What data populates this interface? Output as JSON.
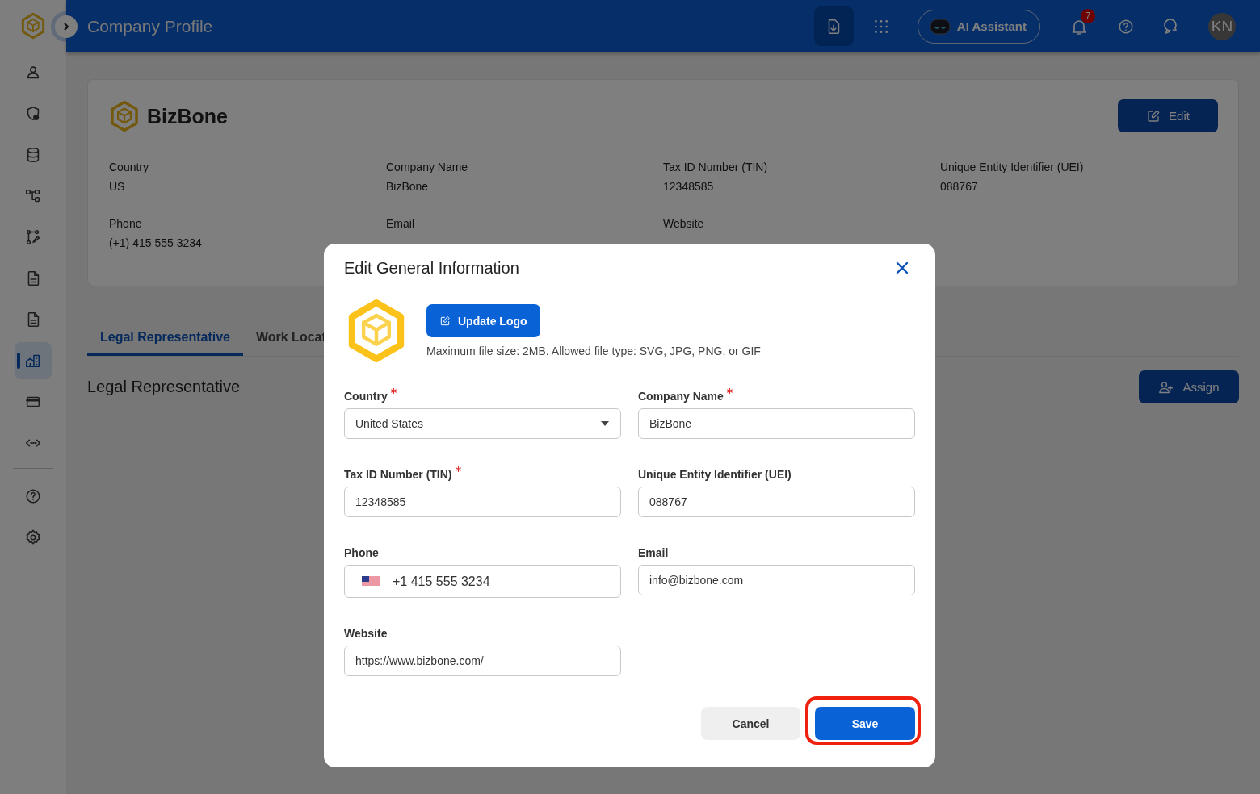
{
  "sidebar": {
    "items": [
      {
        "kind": "person",
        "selected": false
      },
      {
        "kind": "shield",
        "selected": false
      },
      {
        "kind": "database",
        "selected": false
      },
      {
        "kind": "hierarchy",
        "selected": false
      },
      {
        "kind": "workflow",
        "selected": false
      },
      {
        "kind": "document",
        "selected": false
      },
      {
        "kind": "document",
        "selected": false
      },
      {
        "kind": "building",
        "selected": true
      },
      {
        "kind": "card",
        "selected": false
      },
      {
        "kind": "code",
        "selected": false
      }
    ],
    "bottom_items": [
      {
        "kind": "help",
        "selected": false
      },
      {
        "kind": "settings",
        "selected": false
      }
    ]
  },
  "header": {
    "title": "Company Profile",
    "ai_button": "AI Assistant",
    "notification_count": "7",
    "avatar_initials": "KN"
  },
  "company_card": {
    "name": "BizBone",
    "edit_button": "Edit",
    "fields": [
      {
        "label": "Country",
        "value": "US"
      },
      {
        "label": "Company Name",
        "value": "BizBone"
      },
      {
        "label": "Tax ID Number (TIN)",
        "value": "12348585"
      },
      {
        "label": "Unique Entity Identifier (UEI)",
        "value": "088767"
      },
      {
        "label": "Phone",
        "value": "(+1) 415 555 3234"
      },
      {
        "label": "Email"
      },
      {
        "label": "Website"
      }
    ]
  },
  "tabs": [
    {
      "label": "Legal Representative",
      "selected": true
    },
    {
      "label": "Work Locat",
      "selected": false
    }
  ],
  "section": {
    "title": "Legal Representative",
    "assign_button": "Assign"
  },
  "dialog": {
    "title": "Edit General Information",
    "update_logo_button": "Update Logo",
    "logo_hint": "Maximum file size: 2MB. Allowed file type: SVG, JPG, PNG, or GIF",
    "fields": [
      {
        "kind": "select",
        "label": "Country",
        "required": true,
        "value": "United States"
      },
      {
        "kind": "text",
        "label": "Company Name",
        "required": true,
        "value": "BizBone"
      },
      {
        "kind": "text",
        "label": "Tax ID Number (TIN)",
        "required": true,
        "value": "12348585"
      },
      {
        "kind": "text",
        "label": "Unique Entity Identifier (UEI)",
        "required": false,
        "value": "088767"
      },
      {
        "kind": "phone",
        "label": "Phone",
        "required": false,
        "value": "+1 415 555 3234"
      },
      {
        "kind": "text",
        "label": "Email",
        "required": false,
        "value": "info@bizbone.com"
      },
      {
        "kind": "text",
        "label": "Website",
        "required": false,
        "value": "https://www.bizbone.com/"
      }
    ],
    "cancel_button": "Cancel",
    "save_button": "Save",
    "save_highlighted": true
  }
}
